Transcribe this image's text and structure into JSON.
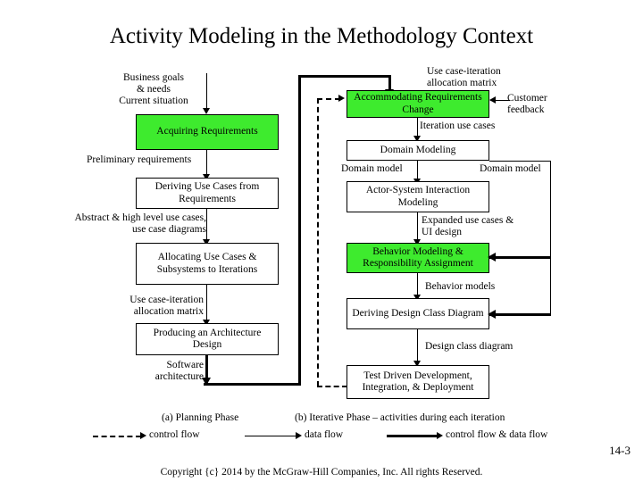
{
  "slide": {
    "title": "Activity Modeling in the Methodology Context",
    "page_number": "14-3",
    "copyright": "Copyright {c} 2014 by the McGraw-Hill Companies, Inc. All rights Reserved."
  },
  "colors": {
    "highlight_green": "#3EEB2E",
    "line": "#000000",
    "background": "#FFFFFF"
  },
  "planning_phase": {
    "caption": "(a) Planning Phase",
    "input_label": "Business goals\n& needs\nCurrent situation",
    "boxes": [
      {
        "id": "acquiring-requirements",
        "label": "Acquiring\nRequirements",
        "highlighted": true
      },
      {
        "id": "deriving-use-cases",
        "label": "Deriving Use Cases\nfrom Requirements",
        "highlighted": false
      },
      {
        "id": "allocating-use-cases",
        "label": "Allocating Use Cases &\nSubsystems\nto Iterations",
        "highlighted": false
      },
      {
        "id": "producing-architecture",
        "label": "Producing an Architecture\nDesign",
        "highlighted": false
      }
    ],
    "flow_labels": [
      {
        "id": "preliminary-requirements",
        "text": "Preliminary requirements"
      },
      {
        "id": "abstract-use-cases",
        "text": "Abstract & high level use cases,\nuse case diagrams"
      },
      {
        "id": "use-case-iteration-matrix-left",
        "text": "Use case-iteration\nallocation matrix"
      },
      {
        "id": "software-architecture",
        "text": "Software\narchitecture"
      }
    ]
  },
  "iterative_phase": {
    "caption": "(b) Iterative Phase – activities during each iteration",
    "boxes": [
      {
        "id": "accommodating-requirements-change",
        "label": "Accommodating\nRequirements Change",
        "highlighted": true
      },
      {
        "id": "domain-modeling",
        "label": "Domain Modeling",
        "highlighted": false
      },
      {
        "id": "actor-system-interaction",
        "label": "Actor-System Interaction\nModeling",
        "highlighted": false
      },
      {
        "id": "behavior-modeling",
        "label": "Behavior Modeling &\nResponsibility Assignment",
        "highlighted": true
      },
      {
        "id": "deriving-design-class",
        "label": "Deriving Design Class\nDiagram",
        "highlighted": false
      },
      {
        "id": "test-driven-development",
        "label": "Test Driven Development,\nIntegration, & Deployment",
        "highlighted": false
      }
    ],
    "flow_labels": [
      {
        "id": "use-case-iteration-matrix-right",
        "text": "Use case-iteration\nallocation matrix"
      },
      {
        "id": "customer-feedback",
        "text": "Customer\nfeedback"
      },
      {
        "id": "iteration-use-cases",
        "text": "Iteration use cases"
      },
      {
        "id": "domain-model-left",
        "text": "Domain model"
      },
      {
        "id": "domain-model-right",
        "text": "Domain model"
      },
      {
        "id": "expanded-use-cases",
        "text": "Expanded use cases &\nUI design"
      },
      {
        "id": "behavior-models",
        "text": "Behavior models"
      },
      {
        "id": "design-class-diagram",
        "text": "Design class diagram"
      }
    ]
  },
  "legend": {
    "items": [
      {
        "id": "control-flow",
        "label": "control flow",
        "style": "dashed"
      },
      {
        "id": "data-flow",
        "label": "data flow",
        "style": "solid-thin"
      },
      {
        "id": "control-and-data-flow",
        "label": "control flow & data flow",
        "style": "solid-thick"
      }
    ]
  }
}
